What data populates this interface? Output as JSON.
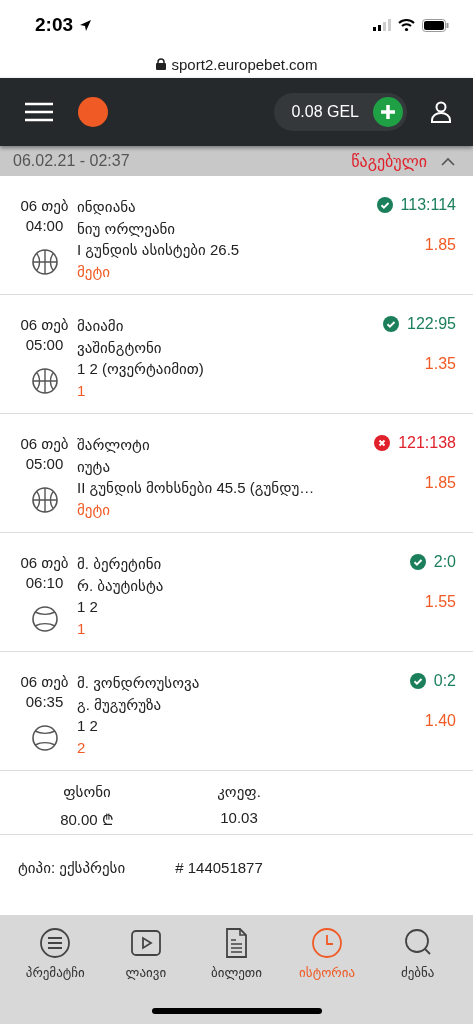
{
  "status_bar": {
    "time": "2:03"
  },
  "browser": {
    "url": "sport2.europebet.com"
  },
  "header": {
    "balance": "0.08 GEL"
  },
  "ticket": {
    "date": "06.02.21 - 02:37",
    "status": "წაგებული",
    "expanded": true
  },
  "bets": [
    {
      "date": "06 თებ",
      "time": "04:00",
      "kind": "basketball",
      "team1": "ინდიანა",
      "team2": "ნიუ ორლეანი",
      "market": "I გუნდის ასისტები 26.5",
      "pick": "მეტი",
      "won": true,
      "score": "113:114",
      "odds": "1.85"
    },
    {
      "date": "06 თებ",
      "time": "05:00",
      "kind": "basketball",
      "team1": "მაიამი",
      "team2": "ვაშინგტონი",
      "market": "1 2 (ოვერტაიმით)",
      "pick": "1",
      "won": true,
      "score": "122:95",
      "odds": "1.35"
    },
    {
      "date": "06 თებ",
      "time": "05:00",
      "kind": "basketball",
      "team1": "შარლოტი",
      "team2": "იუტა",
      "market": "II გუნდის მოხსნები 45.5 (გუნდუ…",
      "pick": "მეტი",
      "won": false,
      "score": "121:138",
      "odds": "1.85"
    },
    {
      "date": "06 თებ",
      "time": "06:10",
      "kind": "tennis",
      "team1": "მ. ბერეტინი",
      "team2": "რ. ბაუტისტა",
      "market": "1 2",
      "pick": "1",
      "won": true,
      "score": "2:0",
      "odds": "1.55"
    },
    {
      "date": "06 თებ",
      "time": "06:35",
      "kind": "tennis",
      "team1": "მ. ვონდროუსოვა",
      "team2": "გ. მუგურუზა",
      "market": "1 2",
      "pick": "2",
      "won": true,
      "score": "0:2",
      "odds": "1.40"
    }
  ],
  "summary": {
    "stake_label": "ფსონი",
    "stake": "80.00 ₾",
    "odds_label": "კოეფ.",
    "odds": "10.03"
  },
  "details": {
    "type": "ტიპი: ექსპრესი",
    "number": "# 144051877"
  },
  "nav": [
    {
      "kind": "prematch",
      "label": "პრემატჩი",
      "selected": false
    },
    {
      "kind": "live",
      "label": "ლაივი",
      "selected": false
    },
    {
      "kind": "ticket",
      "label": "ბილეთი",
      "selected": false
    },
    {
      "kind": "history",
      "label": "ისტორია",
      "selected": true
    },
    {
      "kind": "search",
      "label": "ძებნა",
      "selected": false
    }
  ]
}
